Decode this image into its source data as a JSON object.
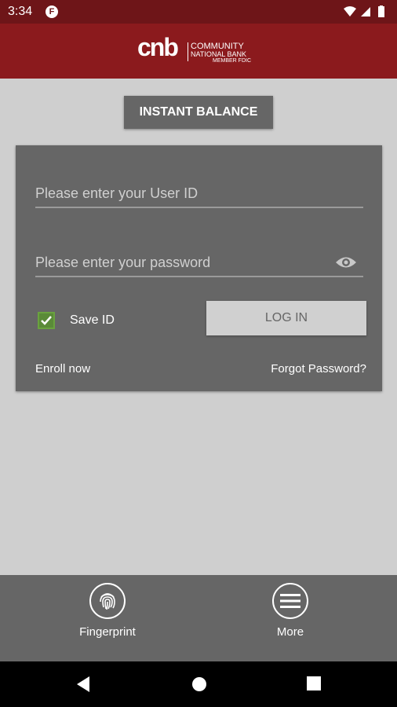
{
  "status": {
    "time": "3:34",
    "notification_icon": "f-icon"
  },
  "brand": {
    "logo_mark": "cnb",
    "line1": "COMMUNITY",
    "line2": "NATIONAL BANK",
    "line3": "MEMBER FDIC"
  },
  "actions": {
    "instant_balance": "INSTANT BALANCE"
  },
  "login": {
    "user_placeholder": "Please enter your User ID",
    "password_placeholder": "Please enter your password",
    "save_id_label": "Save ID",
    "save_id_checked": true,
    "login_button": "LOG IN",
    "enroll": "Enroll now",
    "forgot": "Forgot Password?"
  },
  "bottom_bar": {
    "fingerprint": "Fingerprint",
    "more": "More"
  },
  "colors": {
    "header": "#8b1a1d",
    "status": "#6e1518",
    "card": "#666666",
    "check": "#5a8a38"
  }
}
